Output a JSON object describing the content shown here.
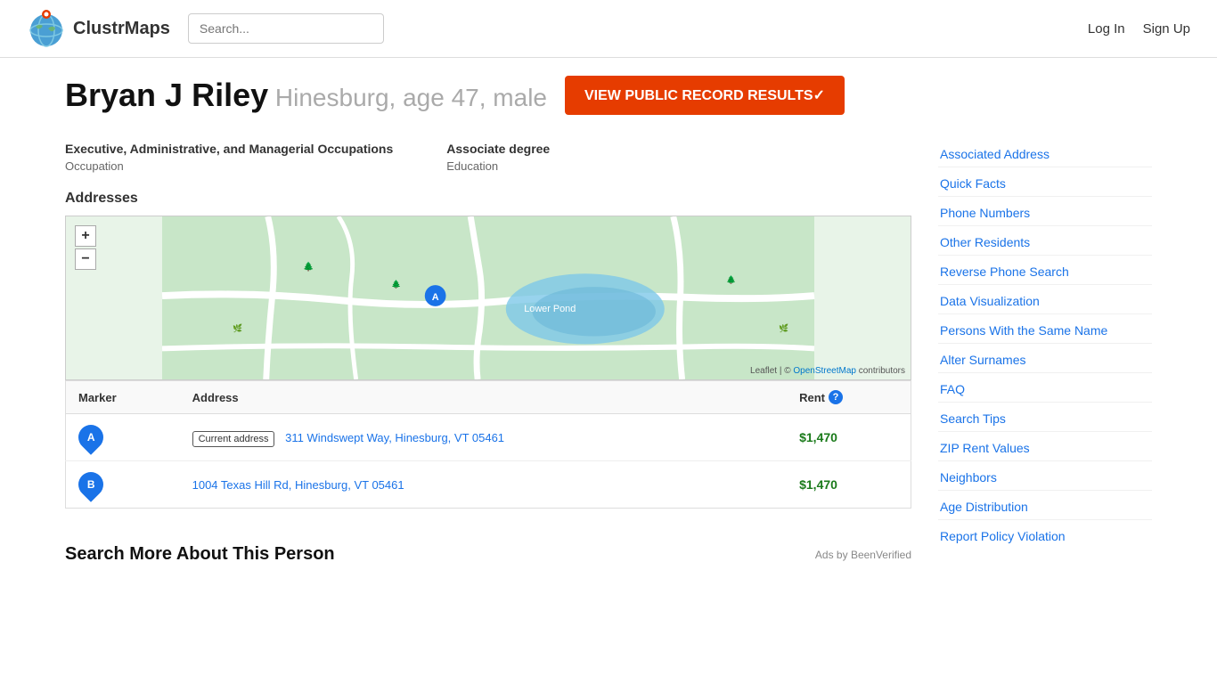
{
  "header": {
    "logo_text": "ClustrMaps",
    "search_placeholder": "Search...",
    "nav": {
      "login": "Log In",
      "signup": "Sign Up"
    }
  },
  "person": {
    "name": "Bryan J Riley",
    "details": "Hinesburg, age 47, male",
    "view_record_btn": "VIEW PUBLIC RECORD RESULTS✓"
  },
  "info": {
    "occupation_title": "Executive, Administrative, and Managerial Occupations",
    "occupation_label": "Occupation",
    "education_title": "Associate degree",
    "education_label": "Education"
  },
  "addresses_section": {
    "title": "Addresses",
    "table": {
      "col_marker": "Marker",
      "col_address": "Address",
      "col_rent": "Rent",
      "rows": [
        {
          "marker": "A",
          "current": true,
          "current_label": "Current address",
          "address": "311 Windswept Way, Hinesburg, VT 05461",
          "rent": "$1,470"
        },
        {
          "marker": "B",
          "current": false,
          "current_label": "",
          "address": "1004 Texas Hill Rd, Hinesburg, VT 05461",
          "rent": "$1,470"
        }
      ]
    }
  },
  "search_more": {
    "title": "Search More About This Person",
    "ads_label": "Ads by BeenVerified"
  },
  "sidebar": {
    "links": [
      "Associated Address",
      "Quick Facts",
      "Phone Numbers",
      "Other Residents",
      "Reverse Phone Search",
      "Data Visualization",
      "Persons With the Same Name",
      "Alter Surnames",
      "FAQ",
      "Search Tips",
      "ZIP Rent Values",
      "Neighbors",
      "Age Distribution",
      "Report Policy Violation"
    ]
  },
  "map": {
    "attribution": "Leaflet | © OpenStreetMap contributors",
    "zoom_in": "+",
    "zoom_out": "−"
  }
}
